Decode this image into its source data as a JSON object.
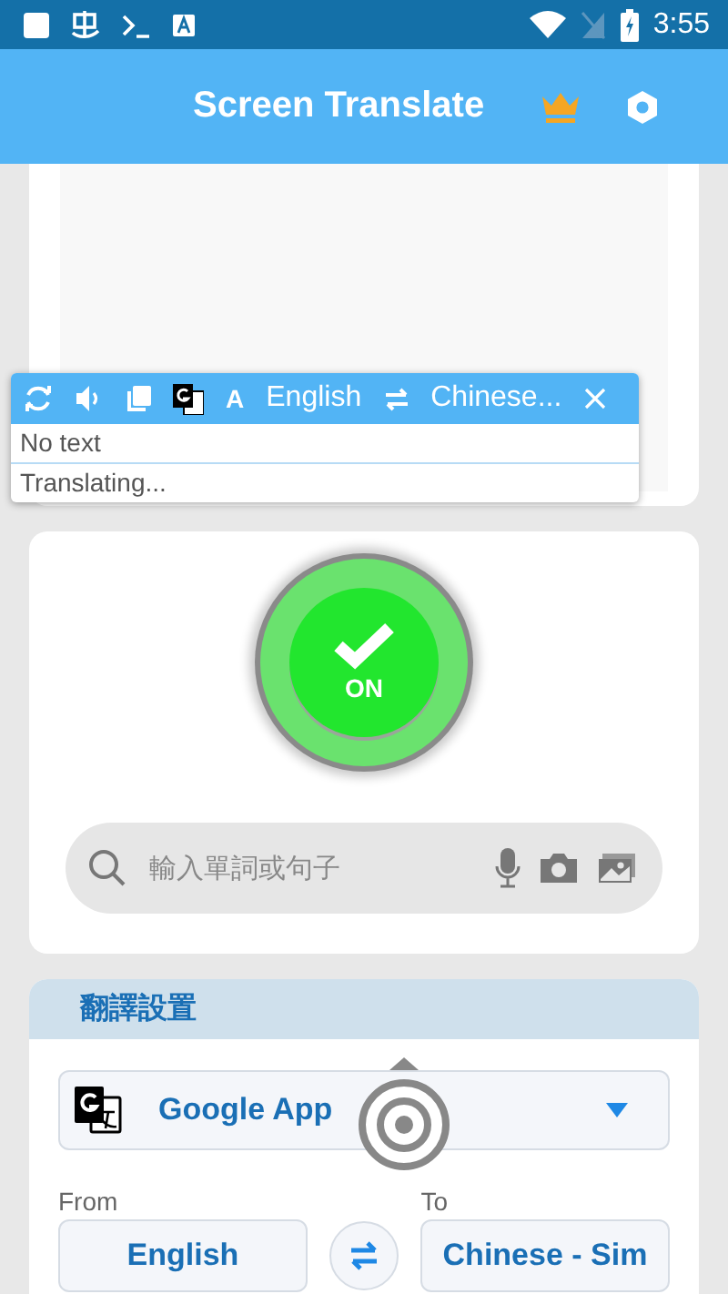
{
  "status_bar": {
    "time": "3:55"
  },
  "app_bar": {
    "title": "Screen Translate"
  },
  "overlay": {
    "font_key": "A",
    "source_language": "English",
    "target_language": "Chinese...",
    "lines": [
      "No text",
      "Translating..."
    ]
  },
  "power_button": {
    "label": "ON",
    "on": true
  },
  "search": {
    "placeholder": "輸入單詞或句子"
  },
  "settings": {
    "title": "翻譯設置",
    "engine": "Google App",
    "from_label": "From",
    "from_value": "English",
    "to_label": "To",
    "to_value": "Chinese - Sim"
  }
}
